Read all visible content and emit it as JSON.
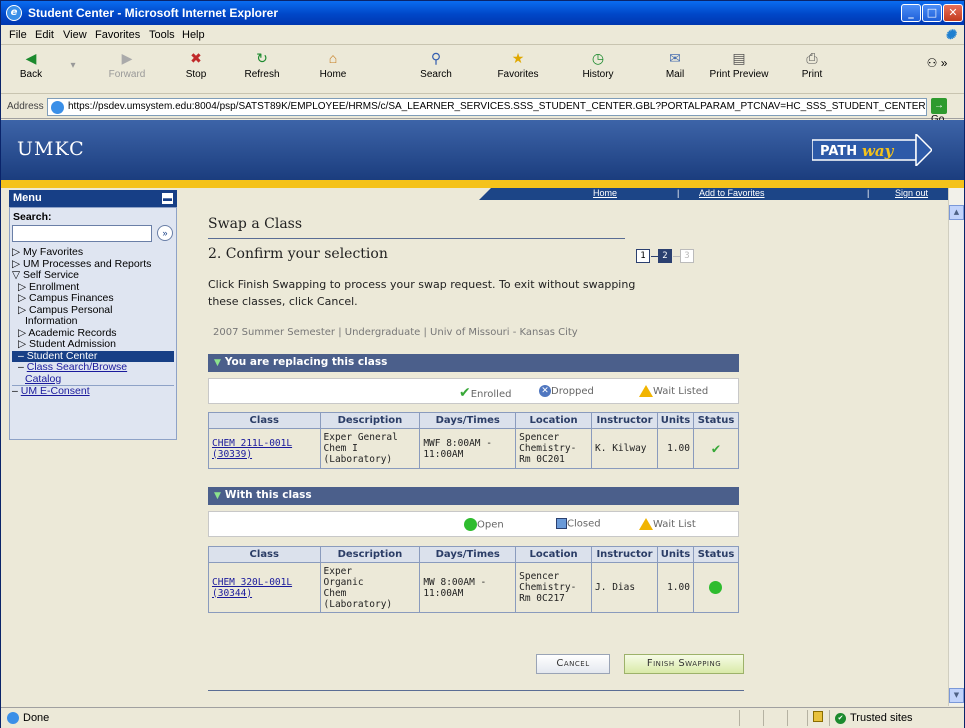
{
  "window": {
    "title": "Student Center - Microsoft Internet Explorer"
  },
  "menubar": [
    "File",
    "Edit",
    "View",
    "Favorites",
    "Tools",
    "Help"
  ],
  "toolbar": {
    "back": "Back",
    "forward": "Forward",
    "stop": "Stop",
    "refresh": "Refresh",
    "home": "Home",
    "search": "Search",
    "favorites": "Favorites",
    "history": "History",
    "mail": "Mail",
    "print_preview": "Print Preview",
    "print": "Print"
  },
  "address": {
    "label": "Address",
    "url": "https://psdev.umsystem.edu:8004/psp/SATST89K/EMPLOYEE/HRMS/c/SA_LEARNER_SERVICES.SSS_STUDENT_CENTER.GBL?PORTALPARAM_PTCNAV=HC_SSS_STUDENT_CENTER&",
    "go": "Go"
  },
  "banner": {
    "logo": "UMKC"
  },
  "topnav": {
    "home": "Home",
    "add_favorites": "Add to Favorites",
    "sign_out": "Sign out"
  },
  "leftnav": {
    "header": "Menu",
    "search_label": "Search:",
    "search_value": "",
    "items": [
      {
        "label": "My Favorites"
      },
      {
        "label": "UM Processes and Reports"
      },
      {
        "label": "Self Service"
      },
      {
        "label": "Enrollment"
      },
      {
        "label": "Campus Finances"
      },
      {
        "label": "Campus Personal"
      },
      {
        "label": "Information"
      },
      {
        "label": "Academic Records"
      },
      {
        "label": "Student Admission"
      },
      {
        "label": "Student Center"
      },
      {
        "label": "Class Search/Browse"
      },
      {
        "label": "Catalog"
      },
      {
        "label": "UM E-Consent"
      }
    ]
  },
  "main": {
    "title": "Swap a Class",
    "subtitle": "2. Confirm your selection",
    "steps": [
      "1",
      "2",
      "3"
    ],
    "instructions": "Click Finish Swapping to process your swap request. To exit without swapping these classes, click Cancel.",
    "term": "2007 Summer Semester | Undergraduate | Univ of Missouri - Kansas City",
    "replacing": {
      "header": "You are replacing this class",
      "legend": [
        "Enrolled",
        "Dropped",
        "Wait Listed"
      ],
      "columns": [
        "Class",
        "Description",
        "Days/Times",
        "Location",
        "Instructor",
        "Units",
        "Status"
      ],
      "row": {
        "class_line1": "CHEM 211L-001L",
        "class_line2": "(30339)",
        "desc_line1": "Exper General",
        "desc_line2": "Chem I",
        "desc_line3": "(Laboratory)",
        "days_line1": "MWF 8:00AM -",
        "days_line2": "11:00AM",
        "loc_line1": "Spencer",
        "loc_line2": "Chemistry-",
        "loc_line3": "Rm 0C201",
        "instructor": "K. Kilway",
        "units": "1.00",
        "status_icon": "enrolled-check-icon"
      }
    },
    "with": {
      "header": "With this class",
      "legend": [
        "Open",
        "Closed",
        "Wait List"
      ],
      "columns": [
        "Class",
        "Description",
        "Days/Times",
        "Location",
        "Instructor",
        "Units",
        "Status"
      ],
      "row": {
        "class_line1": "CHEM 320L-001L",
        "class_line2": "(30344)",
        "desc_line1": "Exper",
        "desc_line2": "Organic",
        "desc_line3": "Chem",
        "desc_line4": "(Laboratory)",
        "days_line1": "MW 8:00AM -",
        "days_line2": "11:00AM",
        "loc_line1": "Spencer",
        "loc_line2": "Chemistry-",
        "loc_line3": "Rm 0C217",
        "instructor": "J. Dias",
        "units": "1.00",
        "status_icon": "open-circle-icon"
      }
    },
    "cancel": "Cancel",
    "finish": "Finish Swapping"
  },
  "statusbar": {
    "done": "Done",
    "zone": "Trusted sites"
  },
  "colors": {
    "banner": "#1b3d7e",
    "stripe": "#f4c21b",
    "section_header": "#4b5f8b",
    "open": "#2ebc2e",
    "enrolled": "#38a838"
  }
}
